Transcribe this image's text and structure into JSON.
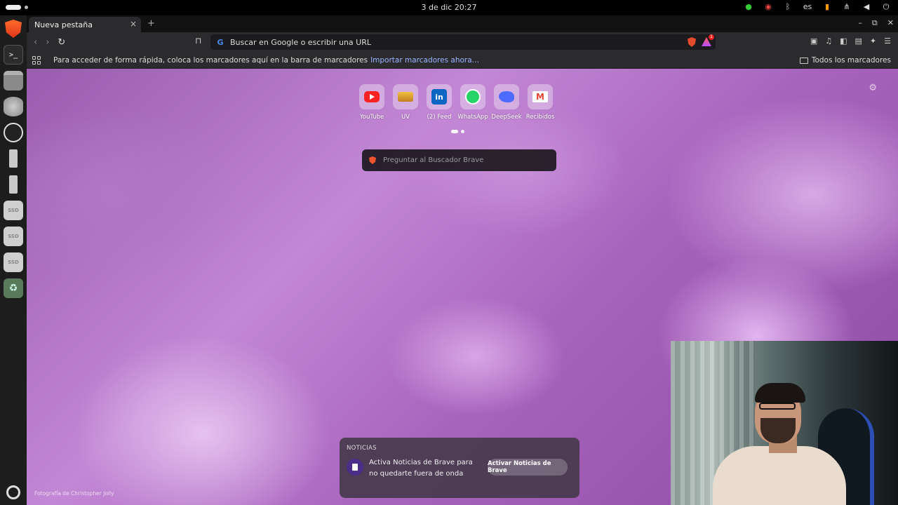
{
  "system": {
    "clock": "3 de dic  20:27",
    "language": "es"
  },
  "browser": {
    "tab_title": "Nueva pestaña",
    "tab_close": "×",
    "new_tab": "+",
    "omnibox_placeholder": "Buscar en Google o escribir una URL",
    "rewards_badge": "1",
    "window_controls": {
      "minimize": "–",
      "maximize": "⧉",
      "close": "✕"
    }
  },
  "bookmarks_bar": {
    "hint": "Para acceder de forma rápida, coloca los marcadores aquí en la barra de marcadores",
    "import_link": "Importar marcadores ahora…",
    "all_bookmarks": "Todos los marcadores"
  },
  "ntp": {
    "top_sites": [
      {
        "label": "YouTube",
        "icon": "youtube-icon"
      },
      {
        "label": "UV",
        "icon": "uv-icon"
      },
      {
        "label": "(2) Feed",
        "icon": "linkedin-icon"
      },
      {
        "label": "WhatsApp",
        "icon": "whatsapp-icon"
      },
      {
        "label": "DeepSeek",
        "icon": "deepseek-icon"
      },
      {
        "label": "Recibidos",
        "icon": "gmail-icon"
      }
    ],
    "search_placeholder": "Preguntar al Buscador Brave",
    "photo_credit": "Fotografía de Christopher Jolly",
    "news": {
      "title": "NOTICIAS",
      "text": "Activa Noticias de Brave para no quedarte fuera de onda",
      "button": "Activar Noticias de Brave"
    }
  },
  "dock": {
    "terminal_glyph": ">_",
    "ssd_label": "SSD",
    "trash_glyph": "♻"
  }
}
